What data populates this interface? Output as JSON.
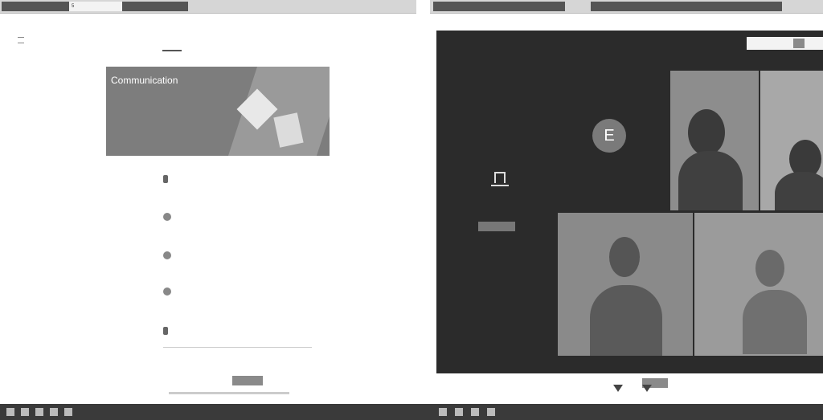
{
  "left_window": {
    "tabs": [
      "",
      "5"
    ],
    "classroom_tab": "",
    "nav_tabs": [
      "",
      "",
      ""
    ],
    "banner": {
      "title": "Communication",
      "subtitle": "",
      "class_code": "",
      "info": ""
    },
    "upcoming": "",
    "posts": [
      "",
      "",
      "",
      "",
      ""
    ],
    "join_button": ""
  },
  "right_window": {
    "window_title": "",
    "meet_title": "",
    "present_text": "",
    "present_button": "",
    "avatar_letter": "E",
    "participants": [
      "",
      "",
      "",
      "",
      ""
    ],
    "bottom_left": ""
  },
  "taskbar": {
    "time": ""
  }
}
